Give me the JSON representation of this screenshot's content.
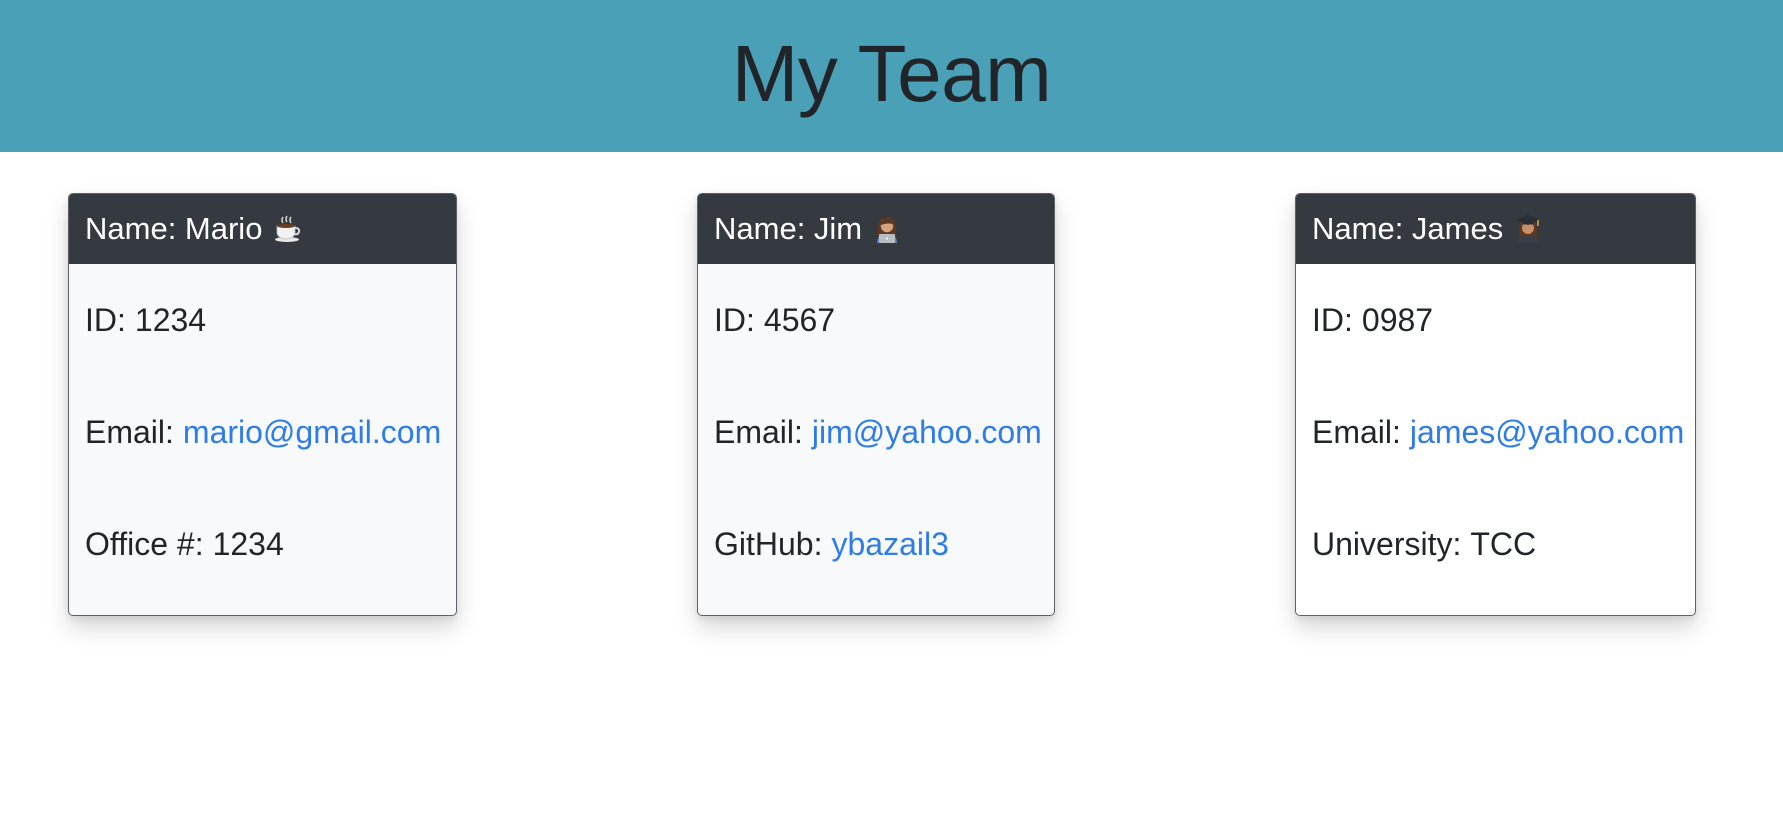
{
  "header": {
    "title": "My Team"
  },
  "cards": [
    {
      "name": "Name: Mario",
      "icon": "coffee-icon",
      "id_label": "ID:",
      "id_value": "1234",
      "email_label": "Email:",
      "email_value": "mario@gmail.com",
      "extra_label": "Office #:",
      "extra_value": "1234",
      "extra_is_link": false
    },
    {
      "name": "Name: Jim",
      "icon": "technologist-icon",
      "id_label": "ID:",
      "id_value": "4567",
      "email_label": "Email:",
      "email_value": "jim@yahoo.com",
      "extra_label": "GitHub:",
      "extra_value": "ybazail3",
      "extra_is_link": true
    },
    {
      "name": "Name: James",
      "icon": "student-icon",
      "id_label": "ID:",
      "id_value": "0987",
      "email_label": "Email:",
      "email_value": "james@yahoo.com",
      "extra_label": "University:",
      "extra_value": "TCC",
      "extra_is_link": false
    }
  ],
  "colors": {
    "banner": "#4aa0b7",
    "card_header": "#343a40",
    "link": "#2e7bea",
    "text": "#212529"
  }
}
